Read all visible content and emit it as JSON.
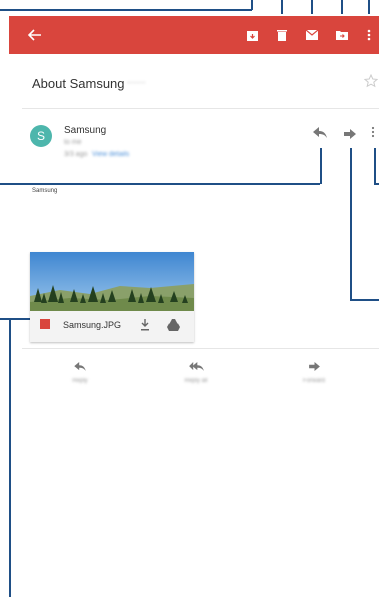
{
  "subject": {
    "title": "About Samsung",
    "label_chip": "·······"
  },
  "message": {
    "avatar_letter": "S",
    "sender": "Samsung",
    "to_line": "to me",
    "date_line": "3/3 ago",
    "view_details": "View details",
    "body": "Samsung"
  },
  "attachment": {
    "filename": "Samsung.JPG"
  },
  "bottom_actions": [
    {
      "label": "Reply"
    },
    {
      "label": "Reply all"
    },
    {
      "label": "Forward"
    }
  ],
  "colors": {
    "appbar": "#d9453d",
    "avatar": "#4db6ac",
    "callout": "#1f4f86",
    "attachment_icon": "#d9453d"
  }
}
